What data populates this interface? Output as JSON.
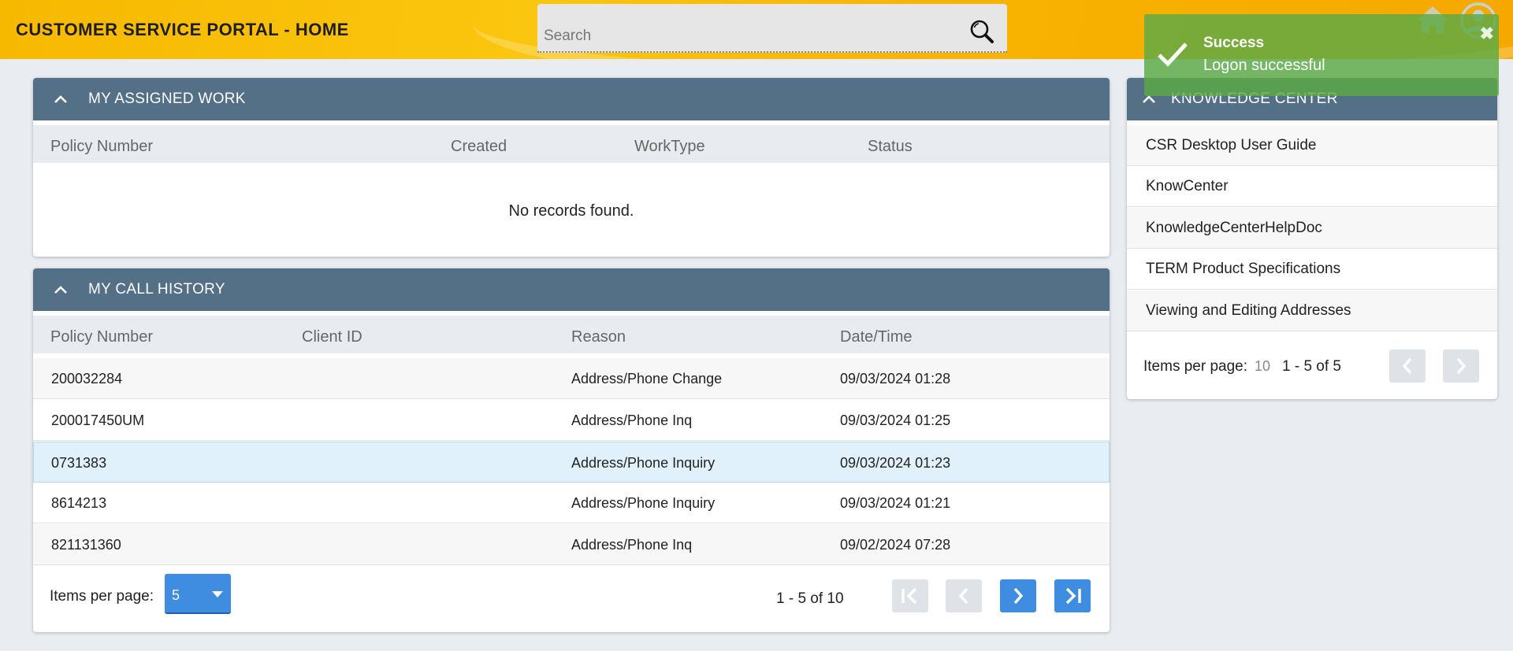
{
  "header": {
    "title": "CUSTOMER SERVICE PORTAL - HOME",
    "search_placeholder": "Search",
    "icons": [
      "search-icon",
      "home-icon",
      "user-icon"
    ]
  },
  "assigned_work": {
    "title": "MY ASSIGNED WORK",
    "columns": [
      "Policy Number",
      "Created",
      "WorkType",
      "Status"
    ],
    "empty_message": "No records found."
  },
  "call_history": {
    "title": "MY CALL HISTORY",
    "columns": [
      "Policy Number",
      "Client ID",
      "Reason",
      "Date/Time"
    ],
    "rows": [
      {
        "policy": "200032284",
        "client_id": "",
        "reason": "Address/Phone Change",
        "datetime": "09/03/2024 01:28"
      },
      {
        "policy": "200017450UM",
        "client_id": "",
        "reason": "Address/Phone Inq",
        "datetime": "09/03/2024 01:25"
      },
      {
        "policy": "0731383",
        "client_id": "",
        "reason": "Address/Phone Inquiry",
        "datetime": "09/03/2024 01:23"
      },
      {
        "policy": "8614213",
        "client_id": "",
        "reason": "Address/Phone Inquiry",
        "datetime": "09/03/2024 01:21"
      },
      {
        "policy": "821131360",
        "client_id": "",
        "reason": "Address/Phone Inq",
        "datetime": "09/02/2024 07:28"
      }
    ],
    "items_per_page_label": "Items per page:",
    "items_per_page_value": "5",
    "range_text": "1 - 5 of 10"
  },
  "knowledge_center": {
    "title": "KNOWLEDGE CENTER",
    "items": [
      "CSR Desktop User Guide",
      "KnowCenter",
      "KnowledgeCenterHelpDoc",
      "TERM Product Specifications",
      "Viewing and Editing Addresses"
    ],
    "items_per_page_label": "Items per page:",
    "items_per_page_value": "10",
    "range_text": "1 - 5 of 5"
  },
  "toast": {
    "title": "Success",
    "message": "Logon successful"
  },
  "colors": {
    "header": "#f9bb05",
    "panel_header": "#537087",
    "accent": "#3f8de0",
    "toast": "#5baa46",
    "selected_row": "#e1f1fb"
  }
}
